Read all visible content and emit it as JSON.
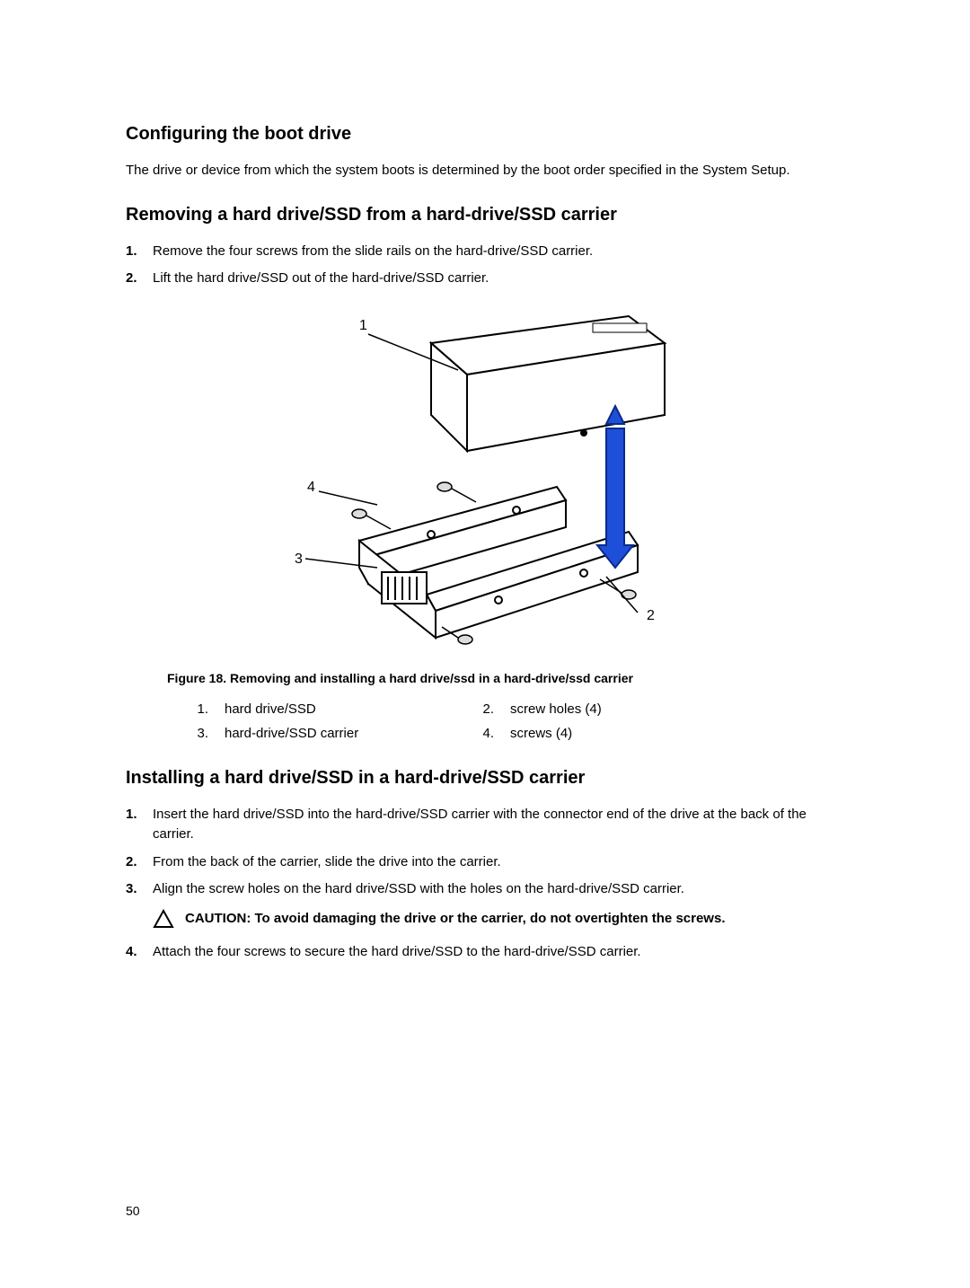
{
  "section1": {
    "heading": "Configuring the boot drive",
    "text": "The drive or device from which the system boots is determined by the boot order specified in the System Setup."
  },
  "section2": {
    "heading": "Removing a hard drive/SSD from a hard-drive/SSD carrier",
    "steps": [
      "Remove the four screws from the slide rails on the hard-drive/SSD carrier.",
      "Lift the hard drive/SSD out of the hard-drive/SSD carrier."
    ]
  },
  "figure": {
    "caption": "Figure 18. Removing and installing a hard drive/ssd in a hard-drive/ssd carrier",
    "callouts": {
      "1": "1",
      "2": "2",
      "3": "3",
      "4": "4"
    },
    "legend": [
      {
        "num": "1.",
        "text": "hard drive/SSD"
      },
      {
        "num": "2.",
        "text": "screw holes (4)"
      },
      {
        "num": "3.",
        "text": "hard-drive/SSD carrier"
      },
      {
        "num": "4.",
        "text": "screws (4)"
      }
    ]
  },
  "section3": {
    "heading": "Installing a hard drive/SSD in a hard-drive/SSD carrier",
    "steps": [
      "Insert the hard drive/SSD into the hard-drive/SSD carrier with the connector end of the drive at the back of the carrier.",
      "From the back of the carrier, slide the drive into the carrier.",
      "Align the screw holes on the hard drive/SSD with the holes on the hard-drive/SSD carrier.",
      "Attach the four screws to secure the hard drive/SSD to the hard-drive/SSD carrier."
    ],
    "caution": "CAUTION: To avoid damaging the drive or the carrier, do not overtighten the screws."
  },
  "pageNumber": "50"
}
